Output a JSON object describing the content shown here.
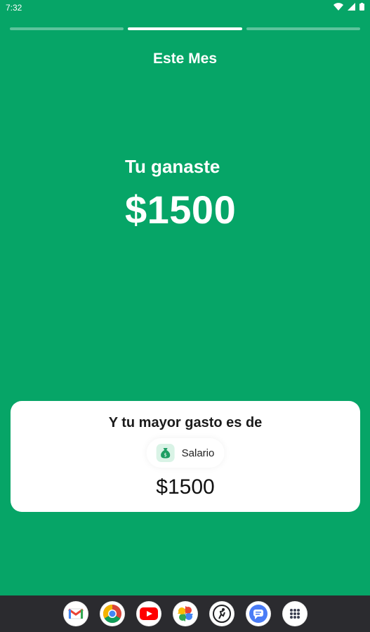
{
  "status": {
    "time": "7:32"
  },
  "story": {
    "segments": 3,
    "active_index": 1
  },
  "period_title": "Este Mes",
  "earned": {
    "label": "Tu ganaste",
    "amount": "$1500"
  },
  "card": {
    "title": "Y tu mayor gasto es de",
    "category": {
      "label": "Salario",
      "icon": "money-bag-icon"
    },
    "amount": "$1500"
  },
  "dock": [
    {
      "name": "gmail-icon"
    },
    {
      "name": "chrome-icon"
    },
    {
      "name": "youtube-icon"
    },
    {
      "name": "photos-icon"
    },
    {
      "name": "fitness-icon"
    },
    {
      "name": "messages-icon"
    },
    {
      "name": "apps-icon"
    }
  ],
  "colors": {
    "background": "#06A567",
    "card": "#FFFFFF",
    "nav": "#2B2B2F"
  }
}
